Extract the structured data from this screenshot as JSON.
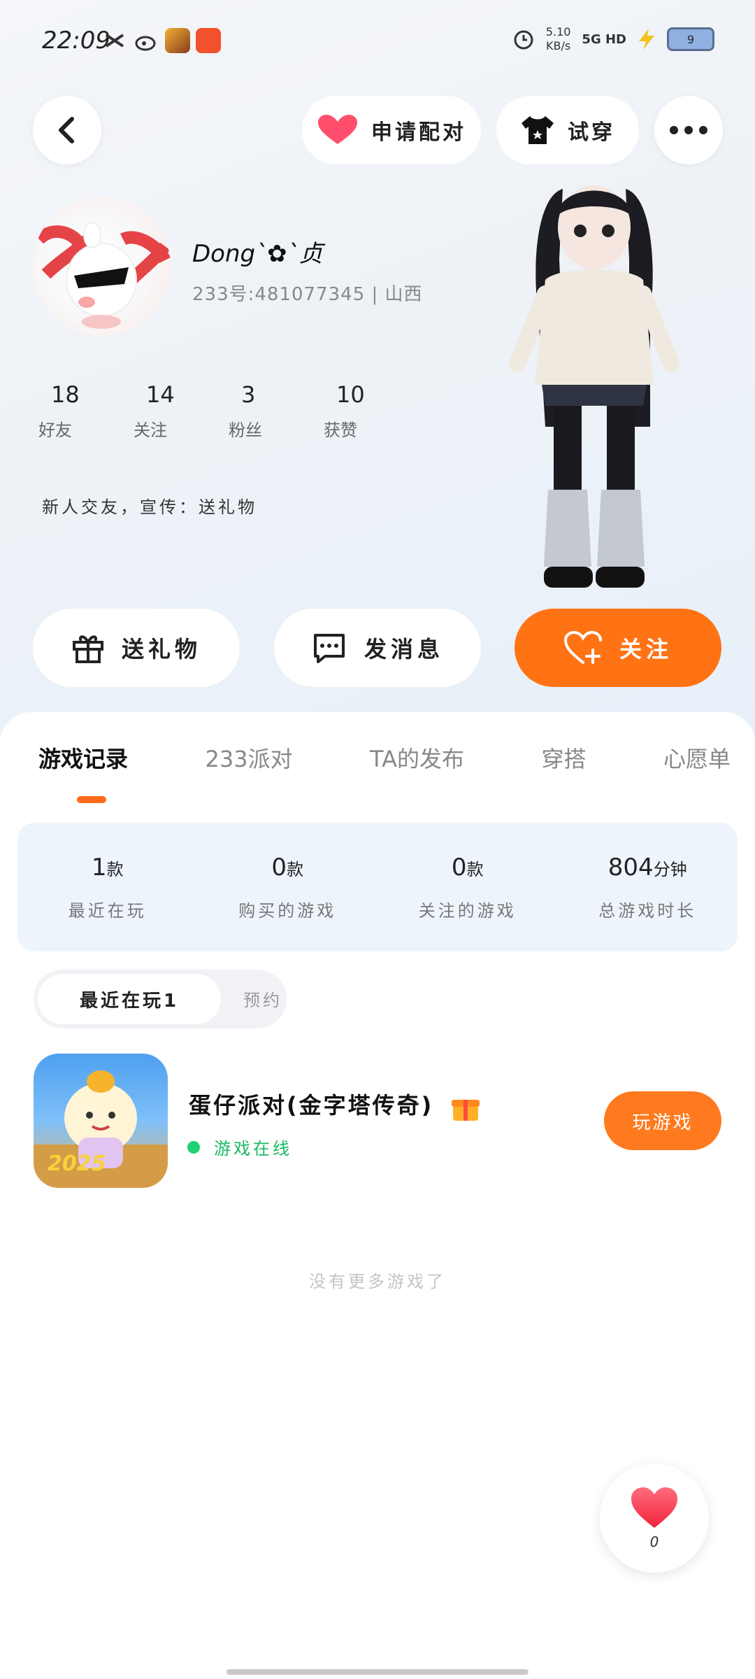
{
  "status_bar": {
    "time": "22:09",
    "network_speed": "5.10\nKB/s",
    "network": "5G HD",
    "battery": "9"
  },
  "header": {
    "match_label": "申请配对",
    "tryon_label": "试穿"
  },
  "profile": {
    "name": "Dong`✿`贞",
    "uid_line": "233号:481077345 | 山西",
    "stats": [
      {
        "value": "18",
        "label": "好友"
      },
      {
        "value": "14",
        "label": "关注"
      },
      {
        "value": "3",
        "label": "粉丝"
      },
      {
        "value": "10",
        "label": "获赞"
      }
    ],
    "bio": "新人交友，宣传：送礼物"
  },
  "actions": {
    "gift_label": "送礼物",
    "message_label": "发消息",
    "follow_label": "关注"
  },
  "tabs": [
    {
      "label": "游戏记录"
    },
    {
      "label": "233派对"
    },
    {
      "label": "TA的发布"
    },
    {
      "label": "穿搭"
    },
    {
      "label": "心愿单"
    }
  ],
  "summary": [
    {
      "value": "1",
      "unit": "款",
      "label": "最近在玩"
    },
    {
      "value": "0",
      "unit": "款",
      "label": "购买的游戏"
    },
    {
      "value": "0",
      "unit": "款",
      "label": "关注的游戏"
    },
    {
      "value": "804",
      "unit": "分钟",
      "label": "总游戏时长"
    }
  ],
  "segment": {
    "active": "最近在玩1",
    "inactive": "预约"
  },
  "game": {
    "title": "蛋仔派对(金字塔传奇)",
    "status": "游戏在线",
    "play_label": "玩游戏",
    "icon_text": "2025"
  },
  "footer_note": "没有更多游戏了",
  "like": {
    "count": "0"
  },
  "colors": {
    "accent": "#ff6a1b",
    "online": "#1fd171"
  }
}
